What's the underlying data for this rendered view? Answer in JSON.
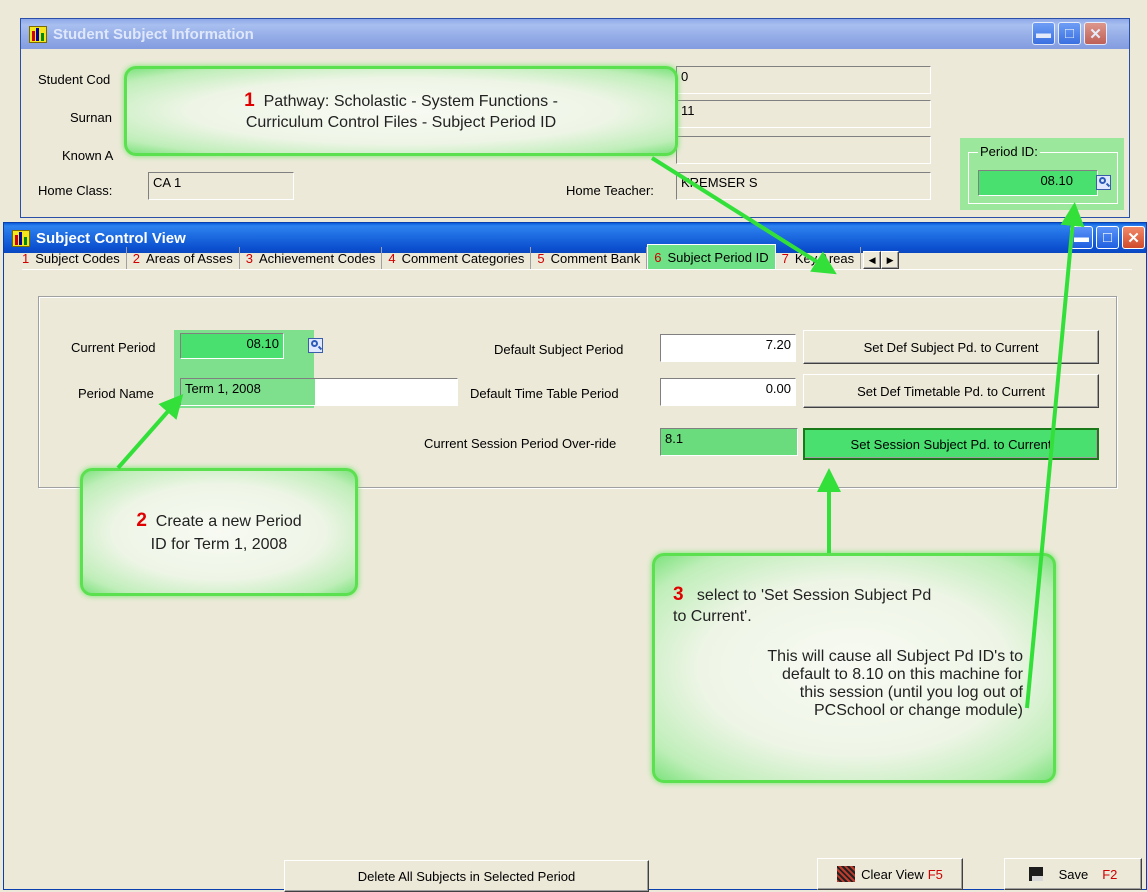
{
  "outer_window": {
    "title": "Student Subject Information",
    "fields": {
      "student_code_label": "Student Cod",
      "surname_label": "Surnan",
      "known_as_label": "Known A",
      "home_class_label": "Home Class:",
      "home_class_value": "CA 1",
      "right_field_1": "0",
      "right_field_2": "11",
      "right_field_3": "",
      "home_teacher_label": "Home Teacher:",
      "home_teacher_value": "KREMSER S"
    },
    "period_id_label": "Period ID:",
    "period_id_value": "08.10"
  },
  "inner_window": {
    "title": "Subject Control View",
    "tabs": [
      {
        "num": "1",
        "label": "Subject Codes"
      },
      {
        "num": "2",
        "label": "Areas of Asses"
      },
      {
        "num": "3",
        "label": "Achievement Codes"
      },
      {
        "num": "4",
        "label": "Comment Categories"
      },
      {
        "num": "5",
        "label": "Comment Bank"
      },
      {
        "num": "6",
        "label": "Subject Period ID"
      },
      {
        "num": "7",
        "label": "Key Areas"
      }
    ],
    "form": {
      "current_period_label": "Current Period",
      "current_period_value": "08.10",
      "period_name_label": "Period Name",
      "period_name_value": "Term 1, 2008",
      "default_subject_period_label": "Default Subject Period",
      "default_subject_period_value": "7.20",
      "default_timetable_period_label": "Default Time Table Period",
      "default_timetable_period_value": "0.00",
      "session_override_label": "Current Session Period Over-ride",
      "session_override_value": "8.1",
      "set_def_subject_btn": "Set Def Subject Pd. to Current",
      "set_def_timetable_btn": "Set Def Timetable Pd. to Current",
      "set_session_btn": "Set Session Subject Pd. to Current"
    },
    "bottom": {
      "delete_btn": "Delete All Subjects in Selected Period",
      "clear_view_label": "Clear View",
      "clear_view_key": "F5",
      "save_label": "Save",
      "save_key": "F2"
    }
  },
  "callouts": {
    "c1": {
      "num": "1",
      "line1": "Pathway:  Scholastic - System Functions -",
      "line2": "Curriculum Control Files - Subject Period ID"
    },
    "c2": {
      "num": "2",
      "line1": "Create a new Period",
      "line2": "ID for Term 1, 2008"
    },
    "c3": {
      "num": "3",
      "line1": "select to 'Set Session Subject Pd",
      "line2": "to Current'.",
      "p2_line1": "This will cause all Subject Pd ID's to",
      "p2_line2": "default to 8.10 on this machine for",
      "p2_line3": "this session (until you log out of",
      "p2_line4": "PCSchool or change module)"
    }
  },
  "colors": {
    "highlight_green": "#5de07a",
    "callout_border": "#5be04f",
    "arrow_green": "#33e03a",
    "number_red": "#e00000"
  }
}
